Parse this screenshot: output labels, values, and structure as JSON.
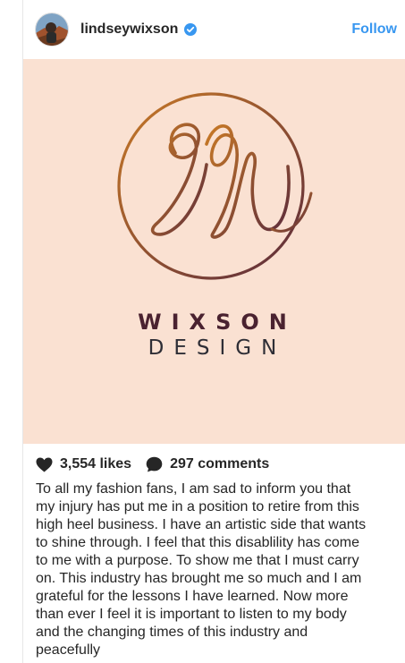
{
  "post": {
    "username": "lindseywixson",
    "follow_label": "Follow",
    "image_text": {
      "line1": "WIXSON",
      "line2": "DESIGN"
    },
    "likes": "3,554 likes",
    "comments": "297 comments",
    "caption": "To all my fashion fans, I am sad to inform you that my injury has put me in a position to retire from this high heel business. I have an artistic side that wants to shine through. I feel that this disablility has come to me with a purpose. To show me that I must carry on. This industry has brought me so much and I am grateful for the lessons I have learned. Now more than ever I feel it is important to listen to my body and the changing times of this industry and peacefully"
  },
  "colors": {
    "accent": "#3897f0",
    "image_background": "#fae1d2",
    "logo_gradient_start": "#c97a26",
    "logo_gradient_end": "#5a2a3c"
  },
  "icons": [
    "verified-badge-icon",
    "heart-icon",
    "comment-bubble-icon"
  ]
}
